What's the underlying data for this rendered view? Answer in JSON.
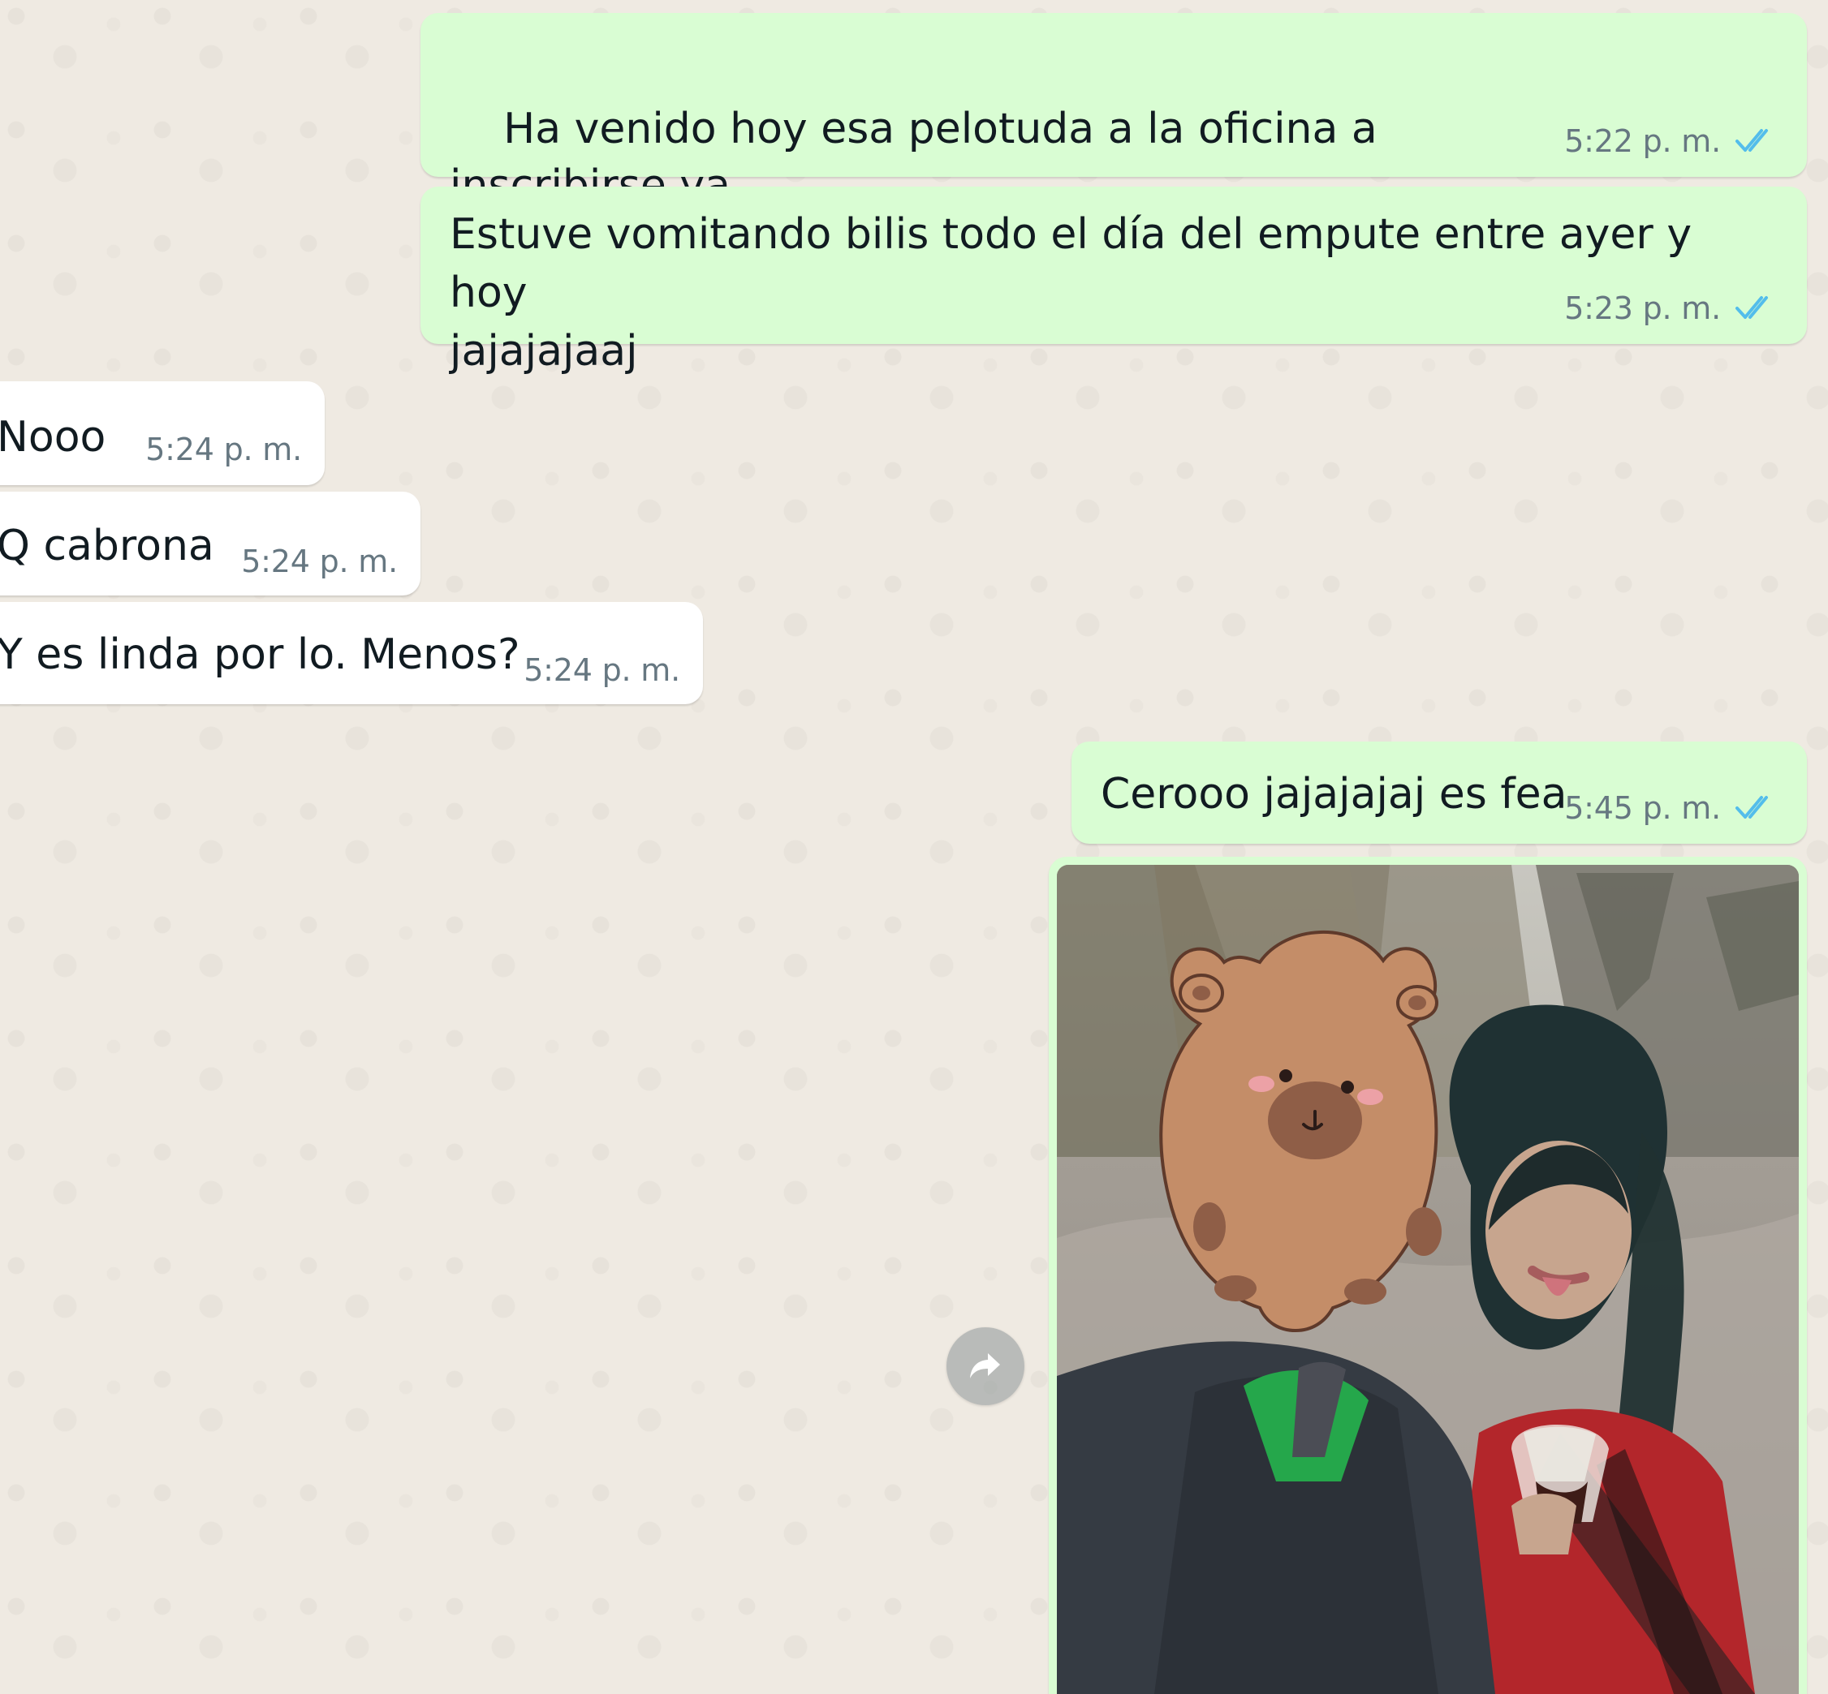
{
  "messages": [
    {
      "id": "m1",
      "direction": "outgoing",
      "text": "Ha venido hoy esa pelotuda a la oficina a inscribirse ya",
      "time": "5:22 p. m.",
      "emoji": "face-with-rolling-eyes-icon",
      "status": "read"
    },
    {
      "id": "m2",
      "direction": "outgoing",
      "text": "Estuve vomitando bilis todo el día del empute entre ayer y hoy\njajajajaaj",
      "time": "5:23 p. m.",
      "status": "read"
    },
    {
      "id": "m3",
      "direction": "incoming",
      "text": "Nooo",
      "time": "5:24 p. m."
    },
    {
      "id": "m4",
      "direction": "incoming",
      "text": "Q cabrona",
      "time": "5:24 p. m."
    },
    {
      "id": "m5",
      "direction": "incoming",
      "text": "Y es linda por lo. Menos?",
      "time": "5:24 p. m."
    },
    {
      "id": "m6",
      "direction": "outgoing",
      "text": "Cerooo jajajajaj es fea",
      "time": "5:45 p. m.",
      "status": "read"
    }
  ],
  "attachments": {
    "forward_icon": "forward-arrow-icon",
    "photo_icon": "photo-icon"
  },
  "colors": {
    "chat_background": "#efeae2",
    "outgoing_bubble": "#d9fdd3",
    "incoming_bubble": "#ffffff",
    "timestamp": "#667781",
    "read_ticks": "#53bdeb"
  }
}
